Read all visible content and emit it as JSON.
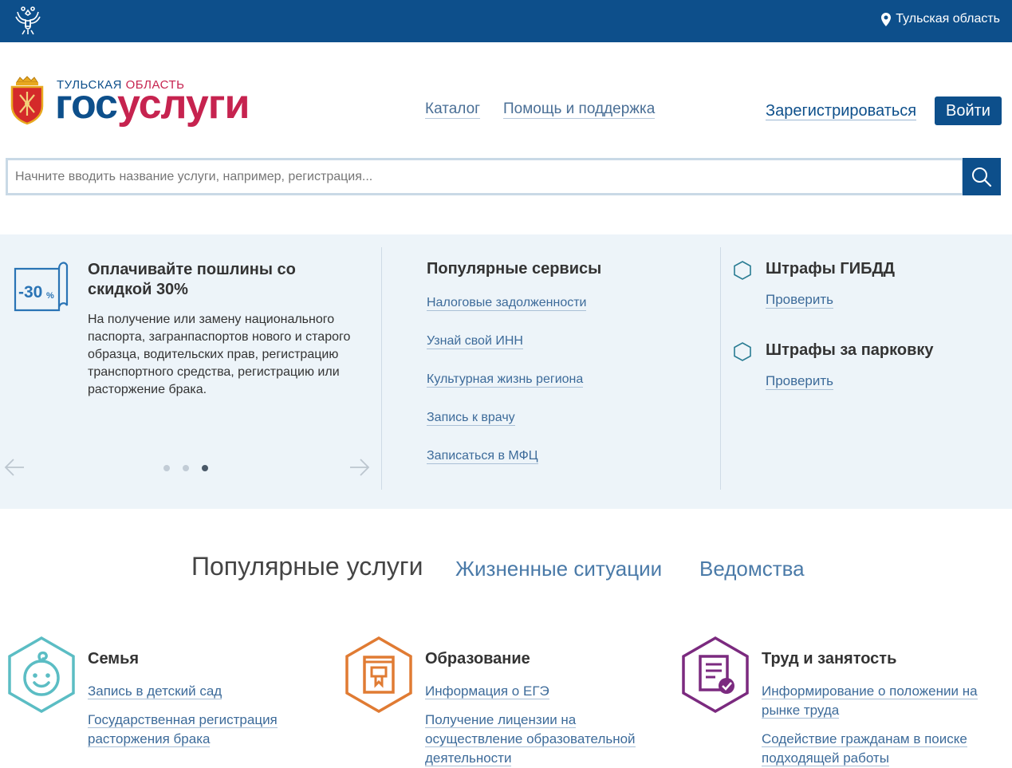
{
  "topbar": {
    "region": "Тульская область"
  },
  "header": {
    "region_part1": "ТУЛЬСКАЯ",
    "region_part2": "ОБЛАСТЬ",
    "brand_part1": "гос",
    "brand_part2": "услуги",
    "nav": [
      "Каталог",
      "Помощь и поддержка"
    ],
    "register": "Зарегистрироваться",
    "login": "Войти"
  },
  "search": {
    "placeholder": "Начните вводить название услуги, например, регистрация..."
  },
  "promo": {
    "badge": "-30",
    "badge_unit": "%",
    "title": "Оплачивайте пошлины со скидкой 30%",
    "text": "На получение или замену национального паспорта, загранпаспортов нового и старого образца, водительских прав, регистрацию транспортного средства, регистрацию или расторжение брака.",
    "slides_total": 3,
    "slide_active": 3
  },
  "popular_services": {
    "title": "Популярные сервисы",
    "items": [
      "Налоговые задолженности",
      "Узнай свой ИНН",
      "Культурная жизнь региона",
      "Запись к врачу",
      "Записаться в МФЦ"
    ]
  },
  "fines": [
    {
      "title": "Штрафы ГИБДД",
      "link": "Проверить"
    },
    {
      "title": "Штрафы за парковку",
      "link": "Проверить"
    }
  ],
  "tabs": [
    "Популярные услуги",
    "Жизненные ситуации",
    "Ведомства"
  ],
  "categories": [
    {
      "title": "Семья",
      "icon": "baby-icon",
      "color": "#5bbdc4",
      "links": [
        "Запись в детский сад",
        "Государственная регистрация расторжения брака"
      ]
    },
    {
      "title": "Образование",
      "icon": "book-icon",
      "color": "#e07b33",
      "links": [
        "Информация о ЕГЭ",
        "Получение лицензии на осуществление образовательной деятельности"
      ]
    },
    {
      "title": "Труд и занятость",
      "icon": "document-check-icon",
      "color": "#7b2a7f",
      "links": [
        "Информирование о положении на рынке труда",
        "Содействие гражданам в поиске подходящей работы"
      ]
    }
  ],
  "colors": {
    "primary": "#0d4f8b",
    "brand_red": "#c6234f",
    "panel_bg": "#edf4f9",
    "link": "#3d6b9a"
  }
}
